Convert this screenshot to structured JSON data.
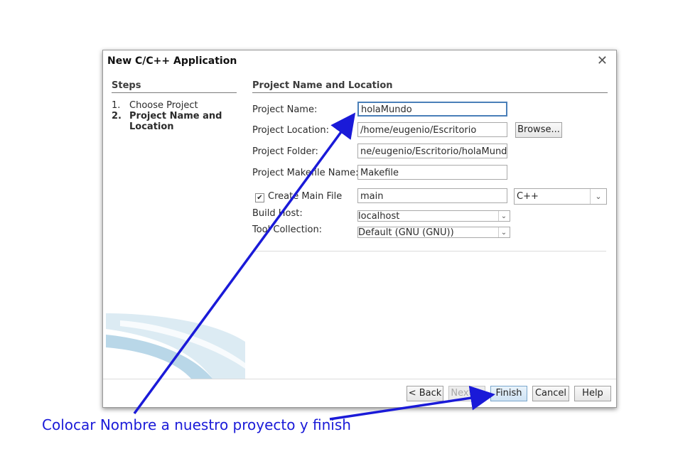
{
  "dialog": {
    "title": "New C/C++ Application",
    "close_glyph": "✕"
  },
  "steps": {
    "heading": "Steps",
    "items": [
      {
        "num": "1.",
        "label": "Choose Project"
      },
      {
        "num": "2.",
        "label": "Project Name and",
        "label2": "Location"
      }
    ]
  },
  "form": {
    "heading": "Project Name and Location",
    "project_name_label": "Project Name:",
    "project_name_value": "holaMundo",
    "project_location_label": "Project Location:",
    "project_location_value": "/home/eugenio/Escritorio",
    "browse_label": "Browse...",
    "project_folder_label": "Project Folder:",
    "project_folder_value": "ne/eugenio/Escritorio/holaMundo",
    "makefile_label": "Project Makefile Name:",
    "makefile_value": "Makefile",
    "create_main_label": "Create Main File",
    "create_main_checked": true,
    "main_value": "main",
    "language_value": "C++",
    "build_host_label": "Build Host:",
    "build_host_value": "localhost",
    "tool_collection_label": "Tool Collection:",
    "tool_collection_value": "Default (GNU (GNU))"
  },
  "buttons": {
    "back": "< Back",
    "next": "Next >",
    "finish": "Finish",
    "cancel": "Cancel",
    "help": "Help"
  },
  "annotation": {
    "text": "Colocar Nombre a nuestro proyecto y finish",
    "color": "#1a1ad8"
  }
}
